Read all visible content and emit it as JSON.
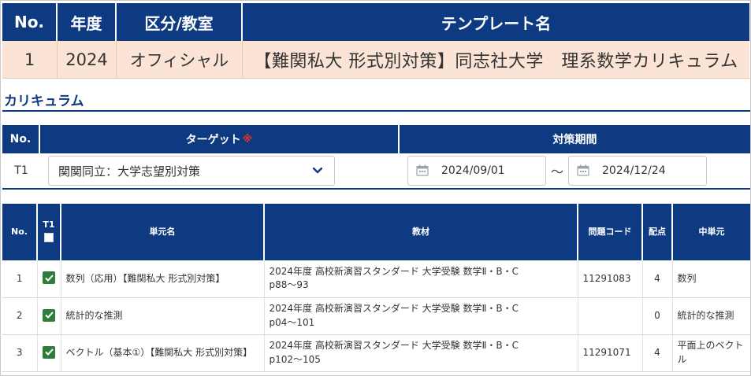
{
  "template": {
    "headers": {
      "no": "No.",
      "year": "年度",
      "category": "区分/教室",
      "name": "テンプレート名"
    },
    "row": {
      "no": "1",
      "year": "2024",
      "category": "オフィシャル",
      "name": "【難関私大 形式別対策】同志社大学　理系数学カリキュラム"
    }
  },
  "section_title": "カリキュラム",
  "curriculum": {
    "headers": {
      "no": "No.",
      "target": "ターゲット",
      "required_mark": "※",
      "period": "対策期間"
    },
    "row": {
      "no": "T1",
      "target_value": "関関同立：大学志望別対策",
      "start_date": "2024/09/01",
      "range_sep": "〜",
      "end_date": "2024/12/24"
    }
  },
  "units": {
    "headers": {
      "no": "No.",
      "t1": "T1",
      "unit_name": "単元名",
      "material": "教材",
      "problem_code": "問題コード",
      "points": "配点",
      "middle_unit": "中単元"
    },
    "rows": [
      {
        "no": "1",
        "checked": true,
        "unit_name": "数列（応用）【難関私大 形式別対策】",
        "material_line1": "2024年度 高校新演習スタンダード 大学受験 数学Ⅱ・B・C",
        "material_line2": "p88〜93",
        "problem_code": "11291083",
        "points": "4",
        "middle_unit": "数列"
      },
      {
        "no": "2",
        "checked": true,
        "unit_name": "統計的な推測",
        "material_line1": "2024年度 高校新演習スタンダード 大学受験 数学Ⅱ・B・C",
        "material_line2": "p04〜101",
        "problem_code": "",
        "points": "0",
        "middle_unit": "統計的な推測"
      },
      {
        "no": "3",
        "checked": true,
        "unit_name": "ベクトル（基本①）【難関私大 形式別対策】",
        "material_line1": "2024年度 高校新演習スタンダード 大学受験 数学Ⅱ・B・C",
        "material_line2": "p102〜105",
        "problem_code": "11291071",
        "points": "4",
        "middle_unit": "平面上のベクトル"
      }
    ]
  },
  "colors": {
    "header_bg": "#0e3a82",
    "template_row_bg": "#fbe4d6",
    "checkbox_green": "#2f7d3a",
    "required_red": "#e4322b"
  },
  "icons": {
    "select_arrow": "chevron-down-icon",
    "date": "calendar-icon",
    "check": "check-icon"
  }
}
